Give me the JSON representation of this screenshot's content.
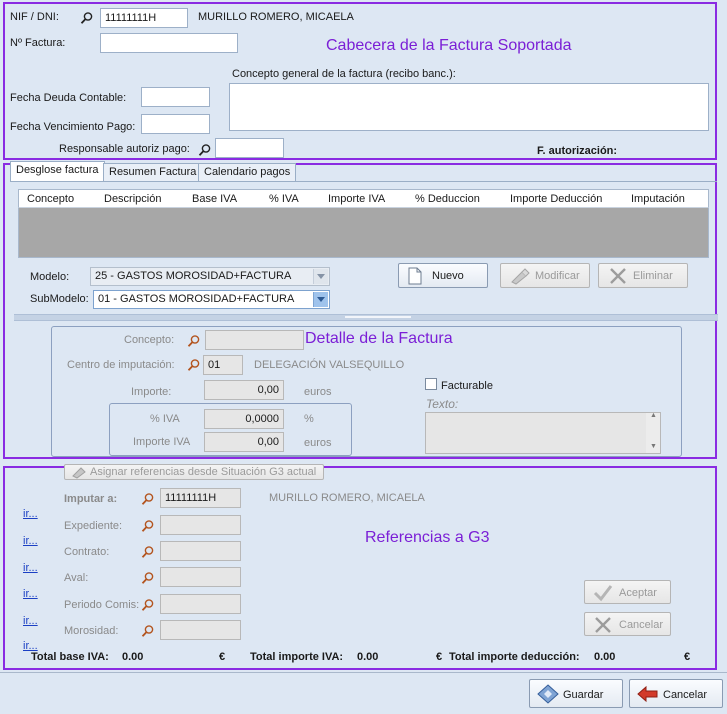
{
  "header": {
    "nif_label": "NIF / DNI:",
    "nif_value": "11111111H",
    "supplier_name": "MURILLO ROMERO, MICAELA",
    "invoice_number_label": "Nº Factura:",
    "invoice_number_value": "",
    "concept_label": "Concepto general de la factura (recibo banc.):",
    "debt_date_label": "Fecha Deuda Contable:",
    "due_date_label": "Fecha Vencimiento Pago:",
    "responsible_label": "Responsable autoriz pago:",
    "auth_date_label": "F. autorización:",
    "annotation": "Cabecera de la Factura Soportada"
  },
  "tabs": [
    "Desglose factura",
    "Resumen Factura",
    "Calendario pagos"
  ],
  "grid": {
    "columns": [
      "Concepto",
      "Descripción",
      "Base IVA",
      "% IVA",
      "Importe IVA",
      "% Deduccion",
      "Importe Deducción",
      "Imputación"
    ]
  },
  "model": {
    "model_label": "Modelo:",
    "model_value": "25 - GASTOS MOROSIDAD+FACTURA",
    "submodel_label": "SubModelo:",
    "submodel_value": "01 - GASTOS MOROSIDAD+FACTURA"
  },
  "actions": {
    "new": "Nuevo",
    "modify": "Modificar",
    "delete": "Eliminar"
  },
  "detail": {
    "annotation": "Detalle de la Factura",
    "concept_label": "Concepto:",
    "center_label": "Centro de imputación:",
    "center_code": "01",
    "center_name": "DELEGACIÓN VALSEQUILLO",
    "amount_label": "Importe:",
    "amount_value": "0,00",
    "amount_unit": "euros",
    "vat_pct_label": "% IVA",
    "vat_pct_value": "0,0000",
    "vat_pct_unit": "%",
    "vat_amount_label": "Importe IVA",
    "vat_amount_value": "0,00",
    "vat_amount_unit": "euros",
    "billable_label": "Facturable",
    "billable_checked": false,
    "text_label": "Texto:"
  },
  "references": {
    "annotation": "Referencias a G3",
    "assign_button": "Asignar referencias desde Situación G3 actual",
    "impute_label": "Imputar a:",
    "impute_value": "11111111H",
    "impute_name": "MURILLO ROMERO, MICAELA",
    "file_label": "Expediente:",
    "contract_label": "Contrato:",
    "guarantee_label": "Aval:",
    "period_label": "Periodo Comis:",
    "default_label": "Morosidad:",
    "links": [
      "ir...",
      "ir...",
      "ir...",
      "ir...",
      "ir...",
      "ir..."
    ],
    "accept": "Aceptar",
    "cancel": "Cancelar"
  },
  "totals": {
    "base_label": "Total base IVA:",
    "base_value": "0.00",
    "vat_label": "Total importe IVA:",
    "vat_value": "0.00",
    "deduction_label": "Total importe deducción:",
    "deduction_value": "0.00",
    "currency": "€"
  },
  "footer": {
    "save": "Guardar",
    "cancel": "Cancelar"
  }
}
